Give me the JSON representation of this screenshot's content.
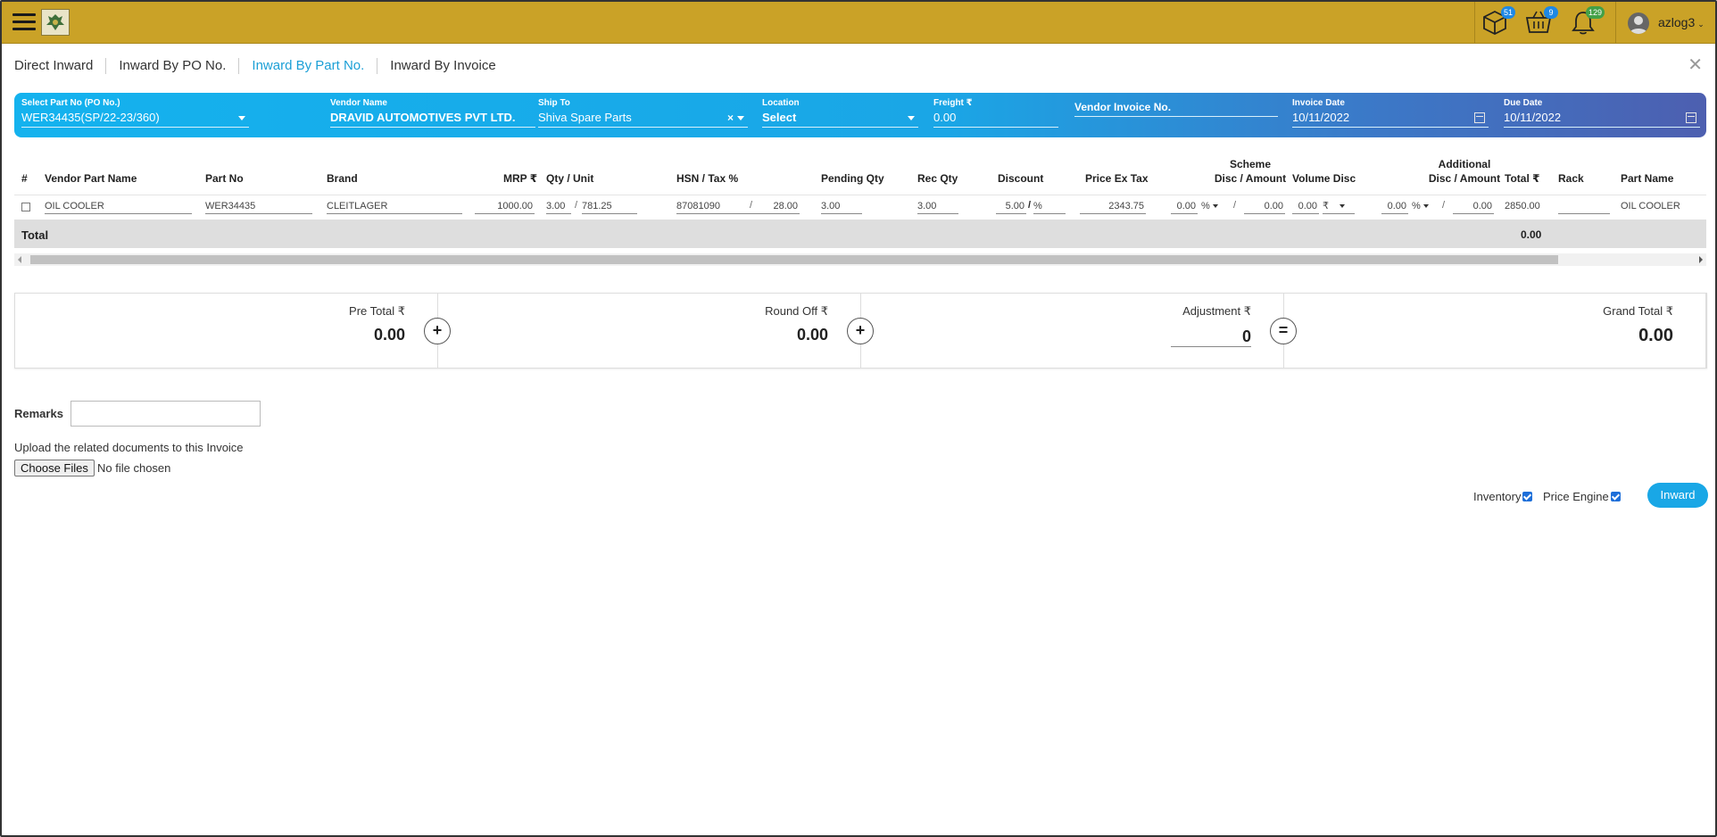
{
  "header": {
    "user_name": "azlog3",
    "badges": {
      "inventory": "51",
      "cart": "9",
      "notifications": "129"
    }
  },
  "tabs": [
    {
      "label": "Direct Inward",
      "active": false
    },
    {
      "label": "Inward By PO No.",
      "active": false
    },
    {
      "label": "Inward By Part No.",
      "active": true
    },
    {
      "label": "Inward By Invoice",
      "active": false
    }
  ],
  "filters": {
    "part_no": {
      "label": "Select Part No (PO No.)",
      "value": "WER34435(SP/22-23/360)"
    },
    "vendor": {
      "label": "Vendor Name",
      "value": "DRAVID AUTOMOTIVES PVT LTD."
    },
    "ship_to": {
      "label": "Ship To",
      "value": "Shiva Spare Parts"
    },
    "location": {
      "label": "Location",
      "value": "Select"
    },
    "freight": {
      "label": "Freight ₹",
      "value": "0.00"
    },
    "vendor_invoice": {
      "placeholder": "Vendor Invoice No."
    },
    "invoice_date": {
      "label": "Invoice Date",
      "value": "10/11/2022"
    },
    "due_date": {
      "label": "Due Date",
      "value": "10/11/2022"
    }
  },
  "table": {
    "headers": {
      "index": "#",
      "vendor_part_name": "Vendor Part Name",
      "part_no": "Part No",
      "brand": "Brand",
      "mrp": "MRP ₹",
      "qty_unit": "Qty / Unit",
      "hsn_tax": "HSN / Tax %",
      "pending_qty": "Pending Qty",
      "rec_qty": "Rec Qty",
      "discount": "Discount",
      "price_ex_tax": "Price Ex Tax",
      "scheme_1": "Scheme",
      "scheme_2": "Disc / Amount",
      "volume_disc": "Volume Disc",
      "additional_1": "Additional",
      "additional_2": "Disc / Amount",
      "total": "Total ₹",
      "rack": "Rack",
      "part_name": "Part Name"
    },
    "rows": [
      {
        "vendor_part_name": "OIL COOLER",
        "part_no": "WER34435",
        "brand": "CLEITLAGER",
        "mrp": "1000.00",
        "qty": "3.00",
        "unit": "781.25",
        "hsn": "87081090",
        "tax": "28.00",
        "pending_qty": "3.00",
        "rec_qty": "3.00",
        "discount": "5.00",
        "discount_type": "%",
        "price_ex_tax": "2343.75",
        "scheme_disc": "0.00",
        "scheme_type": "%",
        "scheme_amount": "0.00",
        "volume_disc": "0.00",
        "volume_type": "₹",
        "additional_disc": "0.00",
        "additional_type": "%",
        "additional_amount": "0.00",
        "total": "2850.00",
        "rack": "",
        "part_name": "OIL COOLER"
      }
    ],
    "footer": {
      "label": "Total",
      "total": "0.00"
    }
  },
  "totals": {
    "pre_total": {
      "label": "Pre Total ₹",
      "value": "0.00"
    },
    "round_off": {
      "label": "Round Off ₹",
      "value": "0.00"
    },
    "adjustment": {
      "label": "Adjustment ₹",
      "value": "0"
    },
    "grand_total": {
      "label": "Grand Total ₹",
      "value": "0.00"
    },
    "op_plus": "+",
    "op_equals": "="
  },
  "form": {
    "remarks_label": "Remarks",
    "upload_label": "Upload the related documents to this Invoice",
    "choose_files": "Choose Files",
    "no_file": "No file chosen",
    "inventory_label": "Inventory",
    "price_engine_label": "Price Engine",
    "inward_button": "Inward"
  },
  "colors": {
    "header": "#caa227",
    "accent": "#1b9fd6",
    "bar_start": "#14b2ee",
    "bar_end": "#4d5fb0"
  }
}
